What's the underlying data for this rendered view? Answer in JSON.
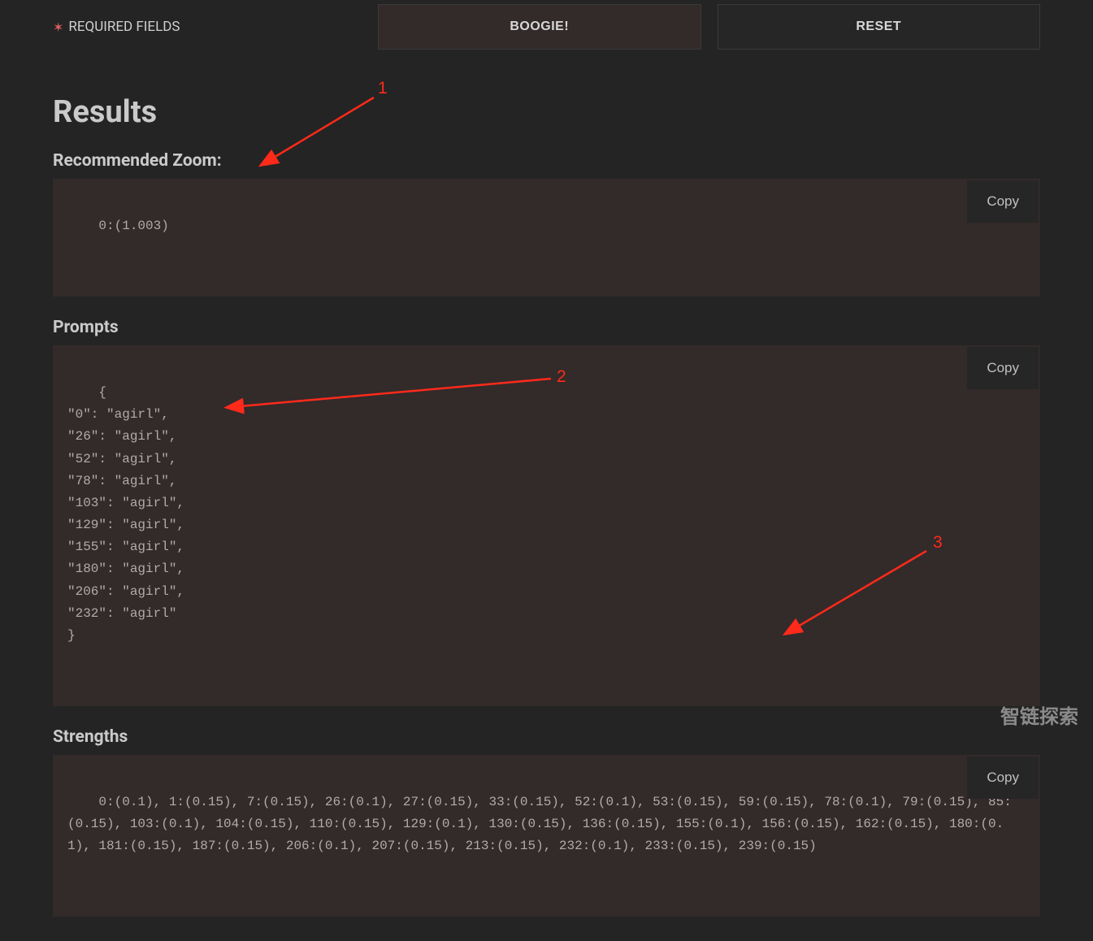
{
  "header": {
    "required_fields_label": "REQUIRED FIELDS",
    "boogie_label": "BOOGIE!",
    "reset_label": "RESET"
  },
  "results": {
    "title": "Results",
    "recommended_zoom_label": "Recommended Zoom:",
    "recommended_zoom_value": "0:(1.003)",
    "prompts_label": "Prompts",
    "prompts_value": "{\n\"0\": \"agirl\",\n\"26\": \"agirl\",\n\"52\": \"agirl\",\n\"78\": \"agirl\",\n\"103\": \"agirl\",\n\"129\": \"agirl\",\n\"155\": \"agirl\",\n\"180\": \"agirl\",\n\"206\": \"agirl\",\n\"232\": \"agirl\"\n}",
    "strengths_label": "Strengths",
    "strengths_value": "0:(0.1), 1:(0.15), 7:(0.15), 26:(0.1), 27:(0.15), 33:(0.15), 52:(0.1), 53:(0.15), 59:(0.15), 78:(0.1), 79:(0.15), 85:(0.15), 103:(0.1), 104:(0.15), 110:(0.15), 129:(0.1), 130:(0.15), 136:(0.15), 155:(0.1), 156:(0.15), 162:(0.15), 180:(0.1), 181:(0.15), 187:(0.15), 206:(0.1), 207:(0.15), 213:(0.15), 232:(0.1), 233:(0.15), 239:(0.15)",
    "copy_label": "Copy"
  },
  "annotations": {
    "n1": "1",
    "n2": "2",
    "n3": "3"
  },
  "watermark": "智链探索"
}
